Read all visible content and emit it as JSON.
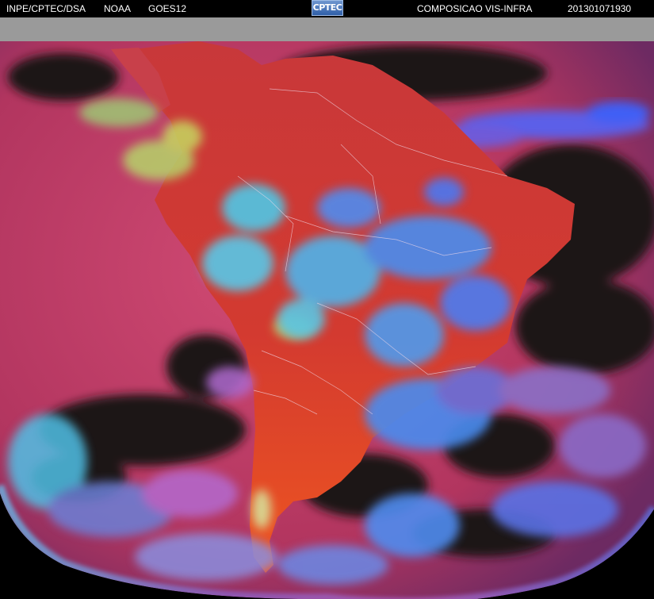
{
  "header": {
    "organization": "INPE/CPTEC/DSA",
    "agency": "NOAA",
    "satellite": "GOES12",
    "product": "COMPOSICAO VIS-INFRA",
    "timestamp": "201301071930"
  },
  "logo": {
    "text": "CPTEC"
  },
  "image": {
    "subject": "satellite-false-color-composite-south-america",
    "colors": {
      "ocean": "#c23a6a",
      "land": "#d8402f",
      "land_south": "#e8501f",
      "cloud_cyan": "#4fc7e6",
      "cloud_blue": "#4f6ef0",
      "cloud_green": "#b8d86a",
      "clear_sky": "#1a1418",
      "no_data": "#9a9a9a",
      "background": "#000000"
    }
  }
}
